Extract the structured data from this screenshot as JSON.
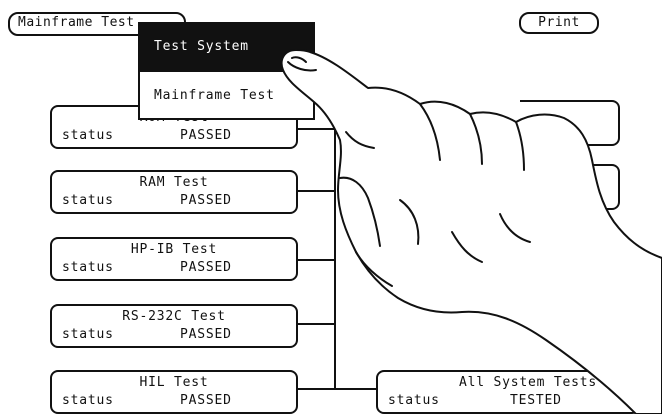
{
  "header": {
    "mainframe_field": "Mainframe Test",
    "print_button": "Print"
  },
  "menu": {
    "items": [
      "Test System",
      "Mainframe Test"
    ],
    "selected_index": 0
  },
  "tests": [
    {
      "name": "ROM Test",
      "status_label": "status",
      "status": "PASSED"
    },
    {
      "name": "RAM Test",
      "status_label": "status",
      "status": "PASSED"
    },
    {
      "name": "HP-IB Test",
      "status_label": "status",
      "status": "PASSED"
    },
    {
      "name": "RS-232C Test",
      "status_label": "status",
      "status": "PASSED"
    },
    {
      "name": "HIL Test",
      "status_label": "status",
      "status": "PASSED"
    }
  ],
  "all_tests": {
    "name": "All System Tests",
    "status_label": "status",
    "status": "TESTED"
  }
}
